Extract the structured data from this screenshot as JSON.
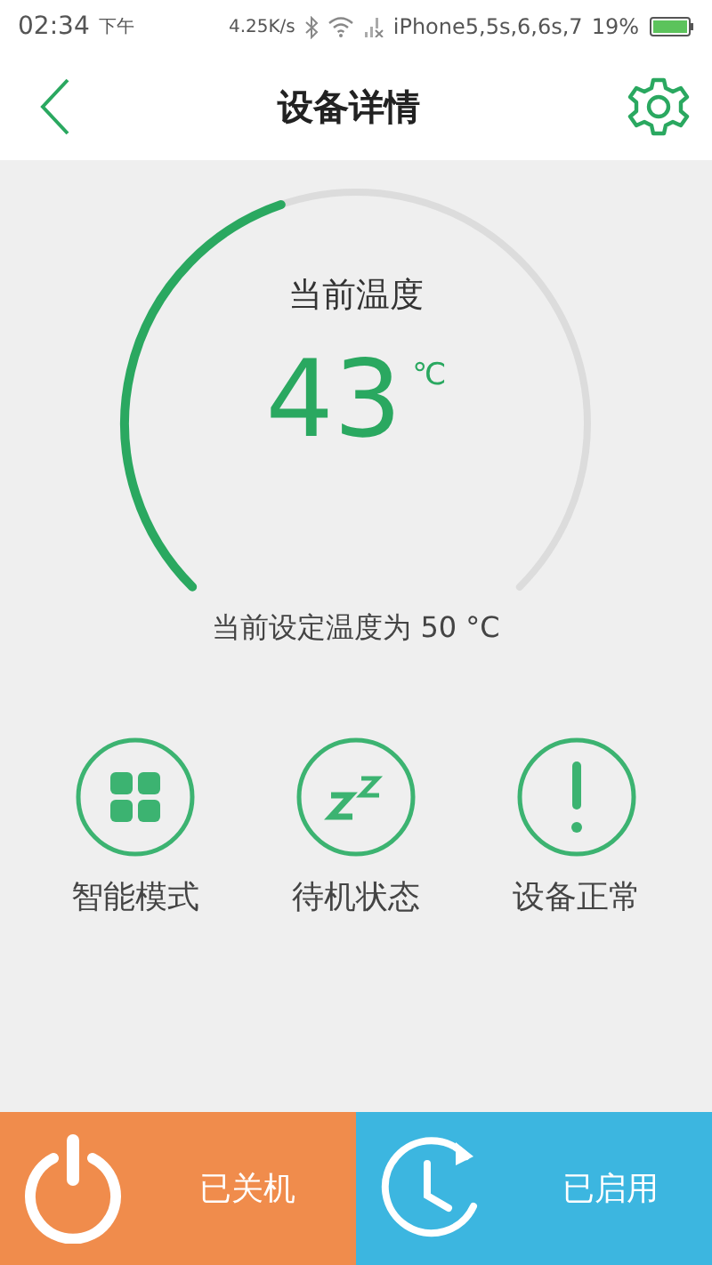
{
  "status_bar": {
    "time": "02:34",
    "period": "下午",
    "speed": "4.25K/s",
    "carrier": "iPhone5,5s,6,6s,7",
    "battery": "19%"
  },
  "header": {
    "title": "设备详情"
  },
  "gauge": {
    "label": "当前温度",
    "value": "43",
    "unit": "℃",
    "setpoint": "当前设定温度为 50 °C"
  },
  "modes": [
    {
      "kind": "grid",
      "label": "智能模式"
    },
    {
      "kind": "sleep",
      "label": "待机状态"
    },
    {
      "kind": "alert",
      "label": "设备正常"
    }
  ],
  "actions": [
    {
      "kind": "power",
      "label": "已关机",
      "color": "#f08c4c"
    },
    {
      "kind": "timer",
      "label": "已启用",
      "color": "#3cb6e0"
    }
  ]
}
